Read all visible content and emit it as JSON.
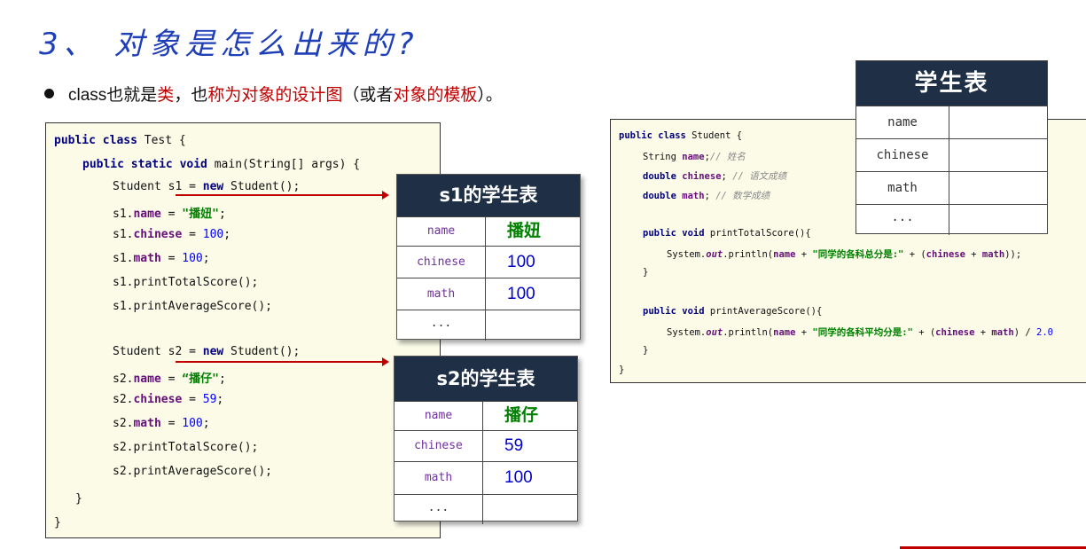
{
  "title": "3、 对象是怎么出来的?",
  "bullet": {
    "p1": "class也就是",
    "p2": "类",
    "p3": "，也",
    "p4": "称为对象的设计图",
    "p5": "（或者",
    "p6": "对象的模板",
    "p7": "）。"
  },
  "test_code": {
    "l1": {
      "kw": "public class",
      "rest": " Test {"
    },
    "l2": {
      "kw": "public static void",
      "rest": " main(String[] args) {"
    },
    "l3": {
      "a": "Student s1 = ",
      "kw": "new",
      "b": " Student();"
    },
    "l4": {
      "a": "s1.",
      "fld": "name",
      "b": " = ",
      "str": "\"播妞\"",
      "c": ";"
    },
    "l5": {
      "a": "s1.",
      "fld": "chinese",
      "b": " = ",
      "num": "100",
      "c": ";"
    },
    "l6": {
      "a": "s1.",
      "fld": "math",
      "b": " = ",
      "num": "100",
      "c": ";"
    },
    "l7": "s1.printTotalScore();",
    "l8": "s1.printAverageScore();",
    "l9": {
      "a": "Student s2 = ",
      "kw": "new",
      "b": " Student();"
    },
    "l10": {
      "a": "s2.",
      "fld": "name",
      "b": " = ",
      "str": "“播仔\"",
      "c": ";"
    },
    "l11": {
      "a": "s2.",
      "fld": "chinese",
      "b": " = ",
      "num": "59",
      "c": ";"
    },
    "l12": {
      "a": "s2.",
      "fld": "math",
      "b": " = ",
      "num": "100",
      "c": ";"
    },
    "l13": "s2.printTotalScore();",
    "l14": "s2.printAverageScore();",
    "l15": "}",
    "l16": "}"
  },
  "s1_table": {
    "header": "s1的学生表",
    "rows": [
      {
        "key": "name",
        "value": "播妞"
      },
      {
        "key": "chinese",
        "value": "100"
      },
      {
        "key": "math",
        "value": "100"
      },
      {
        "key": "...",
        "value": ""
      }
    ]
  },
  "s2_table": {
    "header": "s2的学生表",
    "rows": [
      {
        "key": "name",
        "value": "播仔"
      },
      {
        "key": "chinese",
        "value": "59"
      },
      {
        "key": "math",
        "value": "100"
      },
      {
        "key": "...",
        "value": ""
      }
    ]
  },
  "student_code": {
    "l1": {
      "kw": "public class",
      "rest": " Student {"
    },
    "l2": {
      "a": "String ",
      "fld": "name",
      "b": ";",
      "cmt": "// 姓名"
    },
    "l3": {
      "kw": "double",
      "a": " ",
      "fld": "chinese",
      "b": "; ",
      "cmt": "// 语文成绩"
    },
    "l4": {
      "kw": "double",
      "a": " ",
      "fld": "math",
      "b": "; ",
      "cmt": "// 数学成绩"
    },
    "l5": {
      "kw": "public void",
      "rest": " printTotalScore(){"
    },
    "l6": {
      "a": "System.",
      "it": "out",
      "b": ".println(",
      "fld1": "name",
      "c": " + ",
      "str": "\"同学的各科总分是:\"",
      "d": " + (",
      "fld2": "chinese",
      "e": " + ",
      "fld3": "math",
      "f": "));"
    },
    "l7": "}",
    "l8": {
      "kw": "public void",
      "rest": " printAverageScore(){"
    },
    "l9": {
      "a": "System.",
      "it": "out",
      "b": ".println(",
      "fld1": "name",
      "c": " + ",
      "str": "\"同学的各科平均分是:\"",
      "d": " + (",
      "fld2": "chinese",
      "e": " + ",
      "fld3": "math",
      "f": ") / ",
      "num": "2.0"
    },
    "l10": "}",
    "l11": "}"
  },
  "big_table": {
    "header": "学生表",
    "rows": [
      "name",
      "chinese",
      "math",
      "..."
    ]
  },
  "colors": {
    "accent_red": "#c00000",
    "header_navy": "#1f2f45",
    "title_blue": "#1f3fb8",
    "code_bg": "#fbfbe8"
  }
}
